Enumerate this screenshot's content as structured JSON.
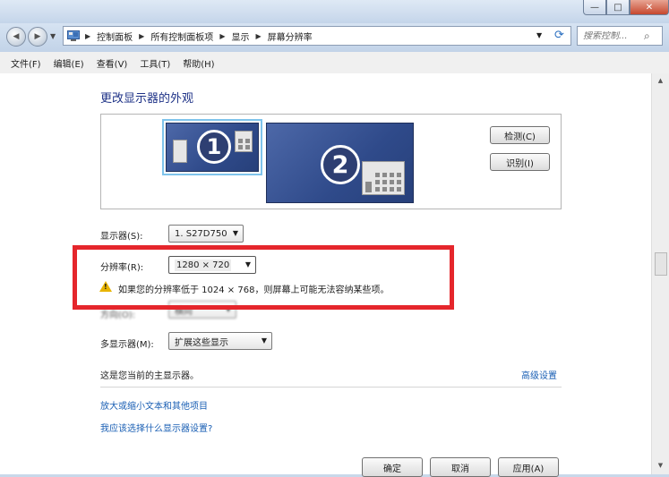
{
  "window": {
    "minimize_glyph": "—",
    "maximize_glyph": "□",
    "close_glyph": "✕"
  },
  "address": {
    "breadcrumbs": [
      "控制面板",
      "所有控制面板项",
      "显示",
      "屏幕分辨率"
    ],
    "search_placeholder": "搜索控制...",
    "back_glyph": "◀",
    "forward_glyph": "▶",
    "refresh_glyph": "⟳",
    "search_glyph": "⌕"
  },
  "menu": [
    "文件(F)",
    "编辑(E)",
    "查看(V)",
    "工具(T)",
    "帮助(H)"
  ],
  "heading": "更改显示器的外观",
  "monitors": [
    {
      "number": "1",
      "selected": true
    },
    {
      "number": "2",
      "selected": false
    }
  ],
  "buttons": {
    "detect": "检测(C)",
    "identify": "识别(I)"
  },
  "settings": {
    "display_label": "显示器(S):",
    "display_value": "1. S27D750",
    "resolution_label": "分辨率(R):",
    "resolution_value": "1280 × 720",
    "warning_text": "如果您的分辨率低于 1024 × 768，则屏幕上可能无法容纳某些项。",
    "orientation_label": "方向(O):",
    "orientation_value": "横向",
    "multi_display_label": "多显示器(M):",
    "multi_display_value": "扩展这些显示"
  },
  "main_display_note": "这是您当前的主显示器。",
  "advanced_link": "高级设置",
  "links": {
    "text_size": "放大或缩小文本和其他项目",
    "which_settings": "我应该选择什么显示器设置?"
  },
  "footer": {
    "ok": "确定",
    "cancel": "取消",
    "apply": "应用(A)"
  },
  "colors": {
    "highlight_border": "#e5262c",
    "monitor_fill": "#3a5596",
    "link": "#1a5fb4",
    "heading": "#1e3287"
  }
}
